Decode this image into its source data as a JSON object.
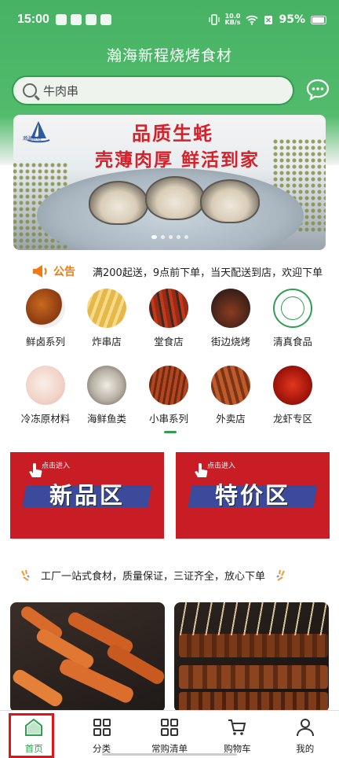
{
  "status_bar": {
    "time": "15:00",
    "speed_top": "10.0",
    "speed_bottom": "KB/s",
    "battery": "95%"
  },
  "app": {
    "title": "瀚海新程烧烤食材"
  },
  "search": {
    "placeholder": "牛肉串",
    "icon": "search-icon",
    "chat_icon": "chat-bubble-icon"
  },
  "banner": {
    "line1": "品质生蚝",
    "line2": "壳薄肉厚  鲜活到家",
    "logo_text": "瀚海新程",
    "slides": 5,
    "active_slide": 0
  },
  "notice": {
    "label": "公告",
    "text": "满200起送，9点前下单，当天配送到店，欢迎下单"
  },
  "categories": [
    {
      "label": "鲜卤系列"
    },
    {
      "label": "炸串店"
    },
    {
      "label": "堂食店"
    },
    {
      "label": "街边烧烤"
    },
    {
      "label": "清真食品"
    },
    {
      "label": "冷冻原材料"
    },
    {
      "label": "海鲜鱼类"
    },
    {
      "label": "小串系列"
    },
    {
      "label": "外卖店"
    },
    {
      "label": "龙虾专区"
    }
  ],
  "promos": [
    {
      "enter": "点击进入",
      "title": "新品区"
    },
    {
      "enter": "点击进入",
      "title": "特价区"
    }
  ],
  "slogan": "工厂一站式食材，质量保证，三证齐全，放心下单",
  "nav": [
    {
      "label": "首页",
      "icon": "home-icon"
    },
    {
      "label": "分类",
      "icon": "grid-icon"
    },
    {
      "label": "常购清单",
      "icon": "grid-icon"
    },
    {
      "label": "购物车",
      "icon": "cart-icon"
    },
    {
      "label": "我的",
      "icon": "user-icon"
    }
  ],
  "colors": {
    "brand_green": "#47b264",
    "promo_red": "#c81d24",
    "notice_orange": "#f07a10",
    "highlight_red": "#e1141a"
  }
}
